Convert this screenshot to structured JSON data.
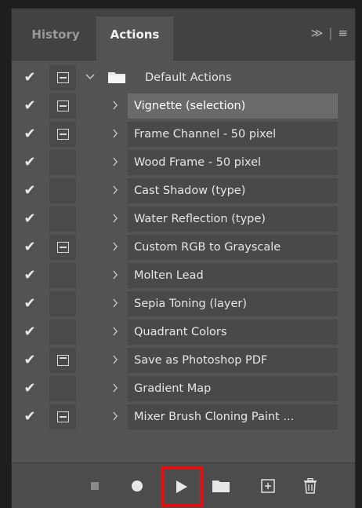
{
  "tabs": {
    "history": "History",
    "actions": "Actions",
    "menu": "≫",
    "menu_sep": "|",
    "menu_icon": "≡"
  },
  "action_set": {
    "name": "Default Actions",
    "checked": "✔"
  },
  "actions": [
    {
      "name": "Vignette (selection)",
      "checked": "✔",
      "dialog": true,
      "selected": true
    },
    {
      "name": "Frame Channel - 50 pixel",
      "checked": "✔",
      "dialog": true
    },
    {
      "name": "Wood Frame - 50 pixel",
      "checked": "✔",
      "dialog": false
    },
    {
      "name": "Cast Shadow (type)",
      "checked": "✔",
      "dialog": false
    },
    {
      "name": "Water Reflection (type)",
      "checked": "✔",
      "dialog": false
    },
    {
      "name": "Custom RGB to Grayscale",
      "checked": "✔",
      "dialog": true
    },
    {
      "name": "Molten Lead",
      "checked": "✔",
      "dialog": false
    },
    {
      "name": "Sepia Toning (layer)",
      "checked": "✔",
      "dialog": false
    },
    {
      "name": "Quadrant Colors",
      "checked": "✔",
      "dialog": false
    },
    {
      "name": "Save as Photoshop PDF",
      "checked": "✔",
      "dialog": true,
      "plain": true
    },
    {
      "name": "Gradient Map",
      "checked": "✔",
      "dialog": false
    },
    {
      "name": "Mixer Brush Cloning Paint ...",
      "checked": "✔",
      "dialog": true
    }
  ],
  "toolbar": {
    "stop": "stop-icon",
    "record": "record-icon",
    "play": "play-icon",
    "new_set": "folder-icon",
    "new_action": "new-action-icon",
    "delete": "trash-icon",
    "highlight_color": "#e01010"
  }
}
